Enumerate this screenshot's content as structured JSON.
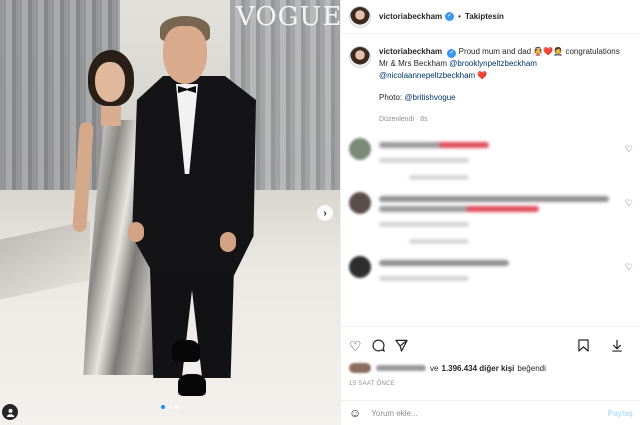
{
  "photo": {
    "magazine_logo": "VOGUE",
    "carousel": {
      "total": 3,
      "current": 1
    },
    "next_icon": "chevron-right-icon",
    "tag_icon": "user-tag-icon"
  },
  "header": {
    "username": "victoriabeckham",
    "verified_icon": "verified-badge-icon",
    "separator": "•",
    "follow_label": "Takiptesin"
  },
  "caption": {
    "username": "victoriabeckham",
    "text_1": "Proud mum and dad",
    "emojis": "👰❤️🤵",
    "text_2": "congratulations Mr & Mrs Beckham",
    "mention_1": "@brooklynpeltzbeckham",
    "mention_2": "@nicolaannepeltzbeckham",
    "heart": "❤️",
    "photo_label": "Photo:",
    "photo_mention": "@britishvogue",
    "edited": "Düzenlendi · 8s"
  },
  "actions": {
    "like_icon": "heart-icon",
    "comment_icon": "comment-icon",
    "share_icon": "paper-plane-icon",
    "save_icon": "bookmark-icon",
    "download_icon": "download-icon"
  },
  "likes": {
    "connector": "ve",
    "count": "1.396.434 diğer kişi",
    "suffix": "beğendi"
  },
  "time_ago": "15 SAAT ÖNCE",
  "add_comment": {
    "emoji_icon": "smiley-icon",
    "placeholder": "Yorum ekle...",
    "post_label": "Paylaş"
  },
  "colors": {
    "link": "#00376b",
    "verified": "#3897f0",
    "post_disabled": "#b2dffc",
    "muted": "#8e8e8e",
    "carousel_active": "#1a8cff"
  }
}
